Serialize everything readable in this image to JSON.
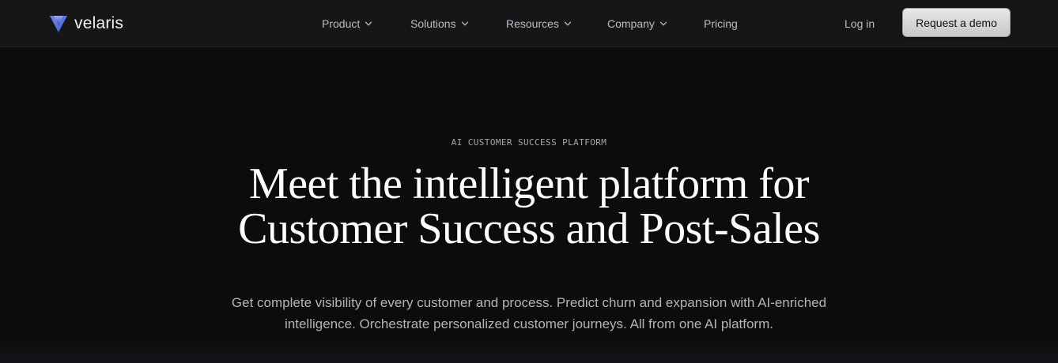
{
  "brand": {
    "name": "velaris",
    "logo_icon": "velaris-logo-icon"
  },
  "nav": {
    "items": [
      {
        "label": "Product",
        "has_dropdown": true
      },
      {
        "label": "Solutions",
        "has_dropdown": true
      },
      {
        "label": "Resources",
        "has_dropdown": true
      },
      {
        "label": "Company",
        "has_dropdown": true
      },
      {
        "label": "Pricing",
        "has_dropdown": false
      }
    ],
    "login_label": "Log in",
    "demo_label": "Request a demo"
  },
  "hero": {
    "eyebrow": "AI CUSTOMER SUCCESS PLATFORM",
    "headline_line1": "Meet the intelligent platform for",
    "headline_line2": "Customer Success and Post-Sales",
    "subtext_line1": "Get complete visibility of every customer and process. Predict churn and expansion with AI-enriched",
    "subtext_line2": "intelligence. Orchestrate personalized customer journeys. All from one AI platform."
  },
  "colors": {
    "page_background": "#0c0c0e",
    "navbar_background": "#161617",
    "nav_text": "#b9bec8",
    "logo_blue": "#4f6fd8",
    "button_background": "#d9d9d9",
    "headline_text": "#ffffff",
    "body_text": "#b4b4b8"
  }
}
